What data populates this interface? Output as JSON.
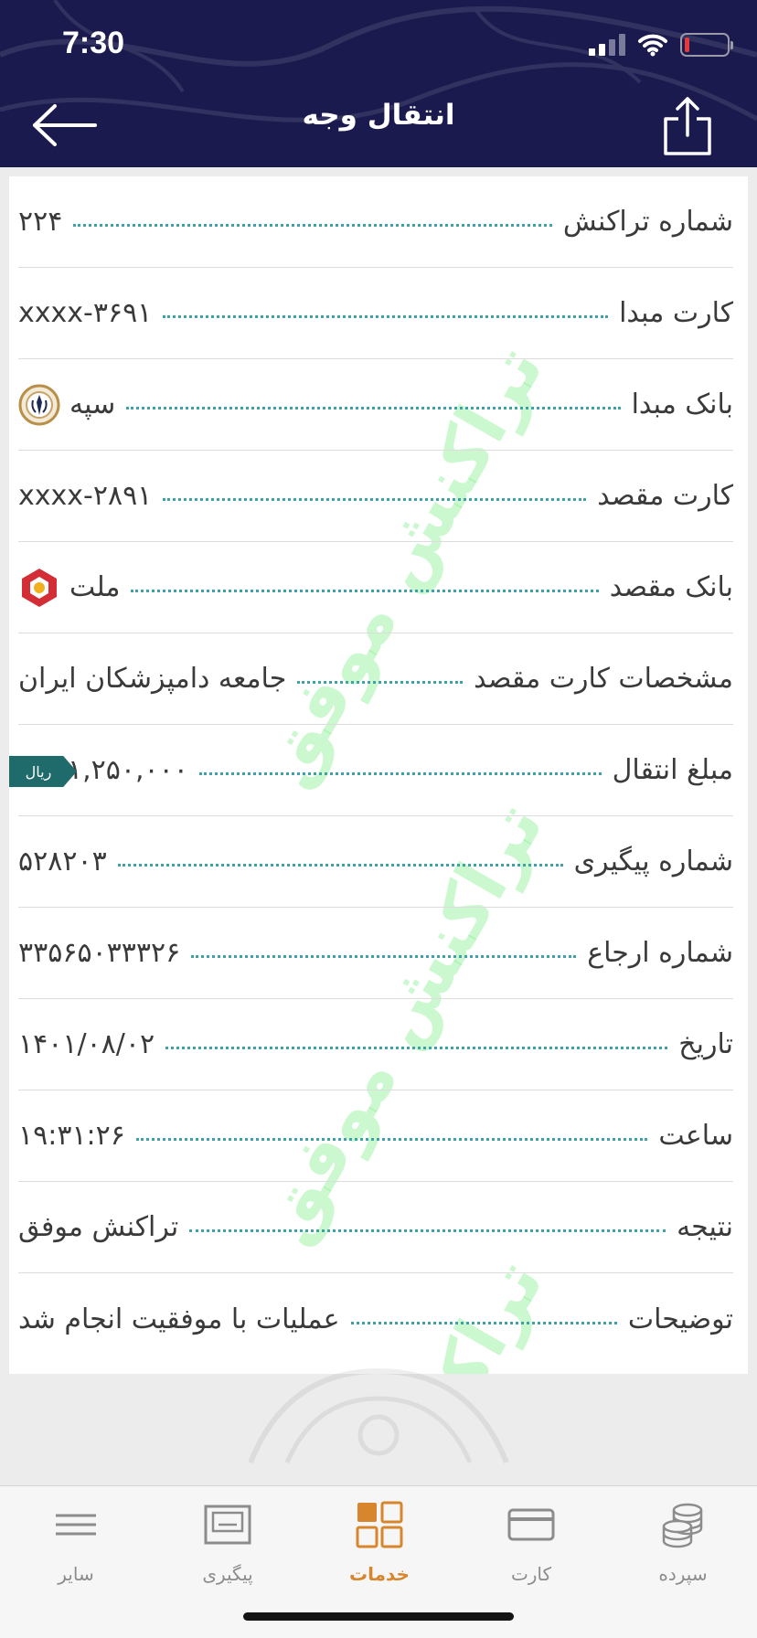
{
  "status_bar": {
    "time": "7:30"
  },
  "header": {
    "title": "انتقال وجه"
  },
  "watermark_text": "تراکنش موفق",
  "rows": [
    {
      "label": "شماره تراکنش",
      "value": "۲۲۴"
    },
    {
      "label": "کارت مبدا",
      "value": "xxxx-۳۶۹۱"
    },
    {
      "label": "بانک مبدا",
      "value": "سپه"
    },
    {
      "label": "کارت مقصد",
      "value": "xxxx-۲۸۹۱"
    },
    {
      "label": "بانک مقصد",
      "value": "ملت"
    },
    {
      "label": "مشخصات کارت مقصد",
      "value": "جامعه دامپزشکان ایران"
    },
    {
      "label": "مبلغ انتقال",
      "value": "۱,۲۵۰,۰۰۰",
      "currency": "ریال"
    },
    {
      "label": "شماره پیگیری",
      "value": "۵۲۸۲۰۳"
    },
    {
      "label": "شماره ارجاع",
      "value": "۳۳۵۶۵۰۳۳۳۲۶"
    },
    {
      "label": "تاریخ",
      "value": "۱۴۰۱/۰۸/۰۲"
    },
    {
      "label": "ساعت",
      "value": "۱۹:۳۱:۲۶"
    },
    {
      "label": "نتیجه",
      "value": "تراکنش موفق"
    },
    {
      "label": "توضیحات",
      "value": "عملیات با موفقیت انجام شد"
    }
  ],
  "tabs": [
    {
      "label": "سایر",
      "icon": "menu-icon",
      "active": false
    },
    {
      "label": "پیگیری",
      "icon": "receipt-icon",
      "active": false
    },
    {
      "label": "خدمات",
      "icon": "grid-icon",
      "active": true
    },
    {
      "label": "کارت",
      "icon": "card-icon",
      "active": false
    },
    {
      "label": "سپرده",
      "icon": "coins-icon",
      "active": false
    }
  ],
  "colors": {
    "header_bg": "#1a1a4e",
    "accent_active": "#d8862e",
    "dotted_leader": "#3fa2a6",
    "currency_badge": "#1f6a6a",
    "watermark": "#6eeb78"
  }
}
